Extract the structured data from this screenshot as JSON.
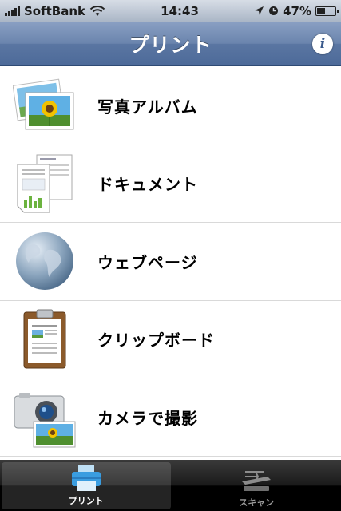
{
  "status_bar": {
    "carrier": "SoftBank",
    "time": "14:43",
    "battery_percent": "47%",
    "battery_level": 0.47,
    "icons": [
      "signal-icon",
      "wifi-icon",
      "location-icon",
      "alarm-icon",
      "battery-icon"
    ]
  },
  "nav": {
    "title": "プリント",
    "info_label": "i"
  },
  "menu": {
    "items": [
      {
        "label": "写真アルバム",
        "icon": "photo-album-icon"
      },
      {
        "label": "ドキュメント",
        "icon": "document-icon"
      },
      {
        "label": "ウェブページ",
        "icon": "globe-icon"
      },
      {
        "label": "クリップボード",
        "icon": "clipboard-icon"
      },
      {
        "label": "カメラで撮影",
        "icon": "camera-icon"
      }
    ]
  },
  "tabs": [
    {
      "label": "プリント",
      "icon": "printer-icon",
      "active": true
    },
    {
      "label": "スキャン",
      "icon": "scanner-icon",
      "active": false
    }
  ],
  "colors": {
    "nav_blue": "#5a76a2",
    "tab_active_icon": "#4aa3e0",
    "divider": "#d9d9d9"
  }
}
